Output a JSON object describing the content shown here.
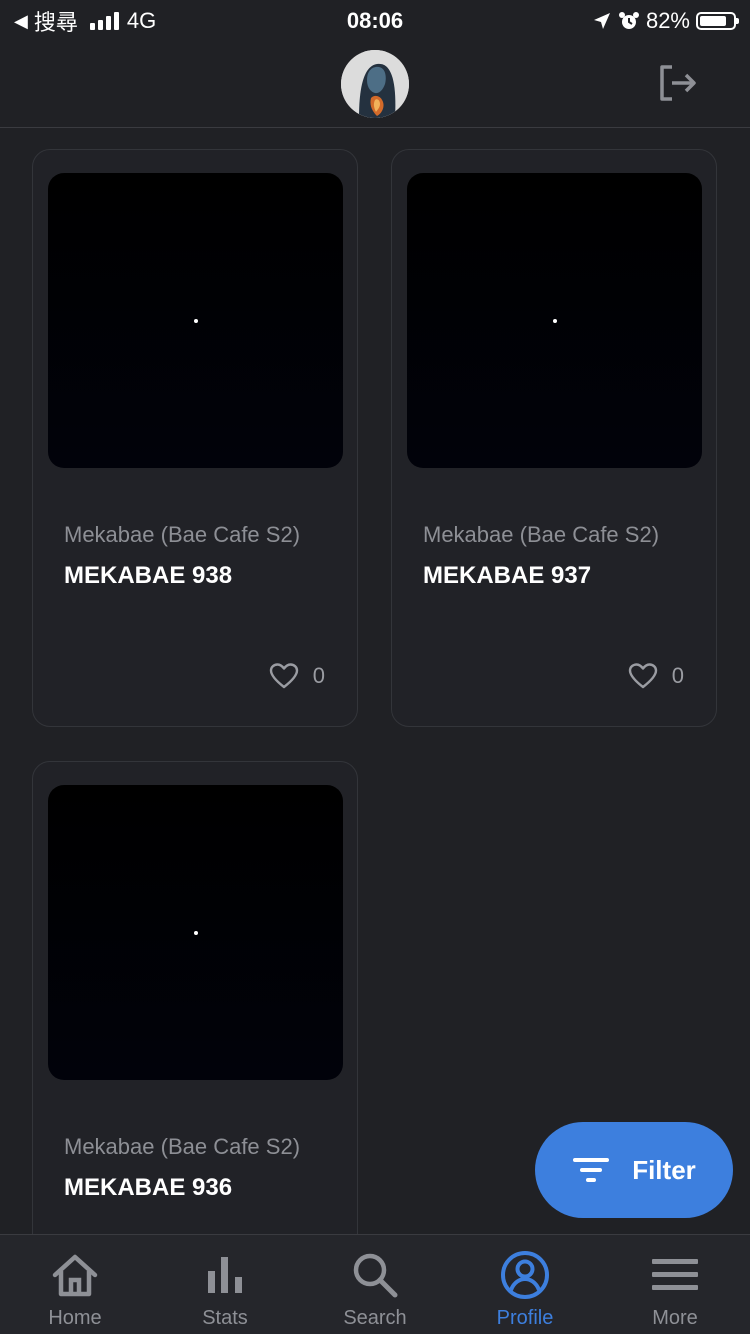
{
  "status_bar": {
    "back_label": "搜尋",
    "network": "4G",
    "time": "08:06",
    "battery_percent": "82%",
    "battery_level": 0.82
  },
  "header": {
    "avatar_icon": "avatar-image",
    "logout_icon": "logout-icon"
  },
  "cards": [
    {
      "collection": "Mekabae (Bae Cafe S2)",
      "name": "MEKABAE 938",
      "likes": "0"
    },
    {
      "collection": "Mekabae (Bae Cafe S2)",
      "name": "MEKABAE 937",
      "likes": "0"
    },
    {
      "collection": "Mekabae (Bae Cafe S2)",
      "name": "MEKABAE 936",
      "likes": ""
    }
  ],
  "fab": {
    "label": "Filter",
    "icon": "filter-icon"
  },
  "nav": [
    {
      "label": "Home",
      "icon": "home-icon"
    },
    {
      "label": "Stats",
      "icon": "stats-icon"
    },
    {
      "label": "Search",
      "icon": "search-icon"
    },
    {
      "label": "Profile",
      "icon": "profile-icon",
      "active": true
    },
    {
      "label": "More",
      "icon": "menu-icon"
    }
  ],
  "colors": {
    "background": "#202125",
    "accent": "#3d7fde",
    "muted_text": "#8d8f95"
  }
}
